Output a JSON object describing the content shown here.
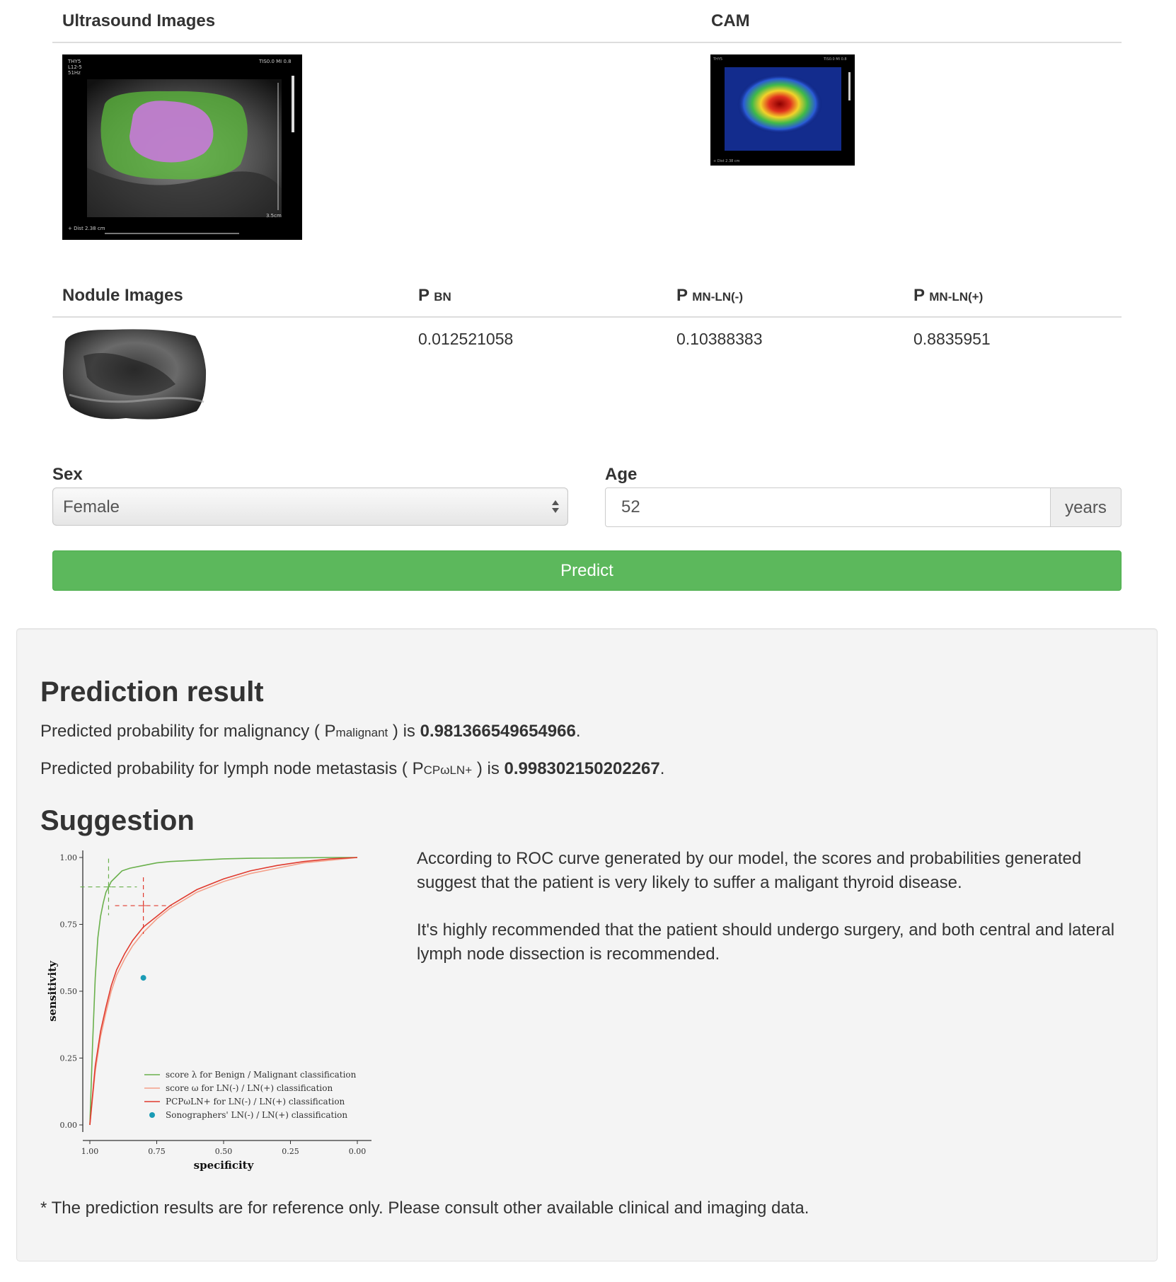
{
  "images_table": {
    "col1_header": "Ultrasound Images",
    "col2_header": "CAM"
  },
  "nodule_table": {
    "col1_header": "Nodule Images",
    "p_bn": {
      "main": "P",
      "sub": "BN",
      "value": "0.012521058"
    },
    "p_mn_ln_neg": {
      "main": "P",
      "sub": "MN-LN(-)",
      "value": "0.10388383"
    },
    "p_mn_ln_pos": {
      "main": "P",
      "sub": "MN-LN(+)",
      "value": "0.8835951"
    }
  },
  "form": {
    "sex_label": "Sex",
    "sex_value": "Female",
    "age_label": "Age",
    "age_value": "52",
    "age_unit": "years",
    "predict_label": "Predict"
  },
  "result": {
    "title": "Prediction result",
    "line1_prefix": "Predicted probability for malignancy ( ",
    "line1_sym_main": "P",
    "line1_sym_sub": "malignant",
    "line1_mid": " ) is ",
    "line1_value": "0.981366549654966",
    "line1_end": ".",
    "line2_prefix": "Predicted probability for lymph node metastasis ( ",
    "line2_sym_main": "P",
    "line2_sym_sub": "CPωLN+",
    "line2_mid": " ) is ",
    "line2_value": "0.998302150202267",
    "line2_end": "."
  },
  "suggestion": {
    "title": "Suggestion",
    "para1": "According to ROC curve generated by our model, the scores and probabilities generated suggest that the patient is very likely to suffer a maligant thyroid disease.",
    "para2": "It's highly recommended that the patient should undergo surgery, and both central and lateral lymph node dissection is recommended."
  },
  "note": "* The prediction results are for reference only. Please consult other available clinical and imaging data.",
  "chart_data": {
    "type": "line",
    "xlabel": "specificity",
    "ylabel": "sensitivity",
    "x_reversed": true,
    "xlim": [
      1.0,
      0.0
    ],
    "ylim": [
      0.0,
      1.0
    ],
    "x_ticks": [
      "1.00",
      "0.75",
      "0.50",
      "0.25",
      "0.00"
    ],
    "y_ticks": [
      "0.00",
      "0.25",
      "0.50",
      "0.75",
      "1.00"
    ],
    "legend_position": "bottom-right",
    "series": [
      {
        "name": "score λ for Benign / Malignant classification",
        "color": "#6ab04c",
        "specificity": [
          1.0,
          0.99,
          0.98,
          0.97,
          0.96,
          0.95,
          0.94,
          0.93,
          0.92,
          0.9,
          0.88,
          0.85,
          0.8,
          0.75,
          0.7,
          0.6,
          0.5,
          0.4,
          0.3,
          0.2,
          0.1,
          0.0
        ],
        "sensitivity": [
          0.0,
          0.3,
          0.55,
          0.7,
          0.78,
          0.83,
          0.87,
          0.89,
          0.91,
          0.93,
          0.95,
          0.96,
          0.97,
          0.98,
          0.985,
          0.99,
          0.995,
          0.997,
          0.998,
          0.999,
          1.0,
          1.0
        ]
      },
      {
        "name": "score ω for LN(-) / LN(+) classification",
        "color": "#f4a08a",
        "specificity": [
          1.0,
          0.98,
          0.96,
          0.94,
          0.92,
          0.9,
          0.87,
          0.84,
          0.8,
          0.75,
          0.7,
          0.65,
          0.6,
          0.5,
          0.4,
          0.3,
          0.2,
          0.1,
          0.0
        ],
        "sensitivity": [
          0.0,
          0.2,
          0.33,
          0.42,
          0.5,
          0.56,
          0.62,
          0.67,
          0.72,
          0.77,
          0.81,
          0.84,
          0.87,
          0.91,
          0.94,
          0.96,
          0.98,
          0.99,
          1.0
        ]
      },
      {
        "name": "PCPωLN+ for LN(-) / LN(+) classification",
        "color": "#e03a2e",
        "specificity": [
          1.0,
          0.98,
          0.96,
          0.94,
          0.92,
          0.9,
          0.87,
          0.84,
          0.8,
          0.75,
          0.7,
          0.65,
          0.6,
          0.5,
          0.4,
          0.3,
          0.2,
          0.1,
          0.0
        ],
        "sensitivity": [
          0.0,
          0.22,
          0.35,
          0.44,
          0.52,
          0.58,
          0.64,
          0.69,
          0.74,
          0.78,
          0.82,
          0.85,
          0.88,
          0.92,
          0.95,
          0.97,
          0.985,
          0.995,
          1.0
        ]
      }
    ],
    "points": [
      {
        "name": "Sonographers' LN(-) / LN(+) classification",
        "color": "#1a9bb5",
        "specificity": 0.8,
        "sensitivity": 0.55
      }
    ],
    "cutoffs": [
      {
        "series": "score λ for Benign / Malignant classification",
        "color": "#6ab04c",
        "specificity": 0.93,
        "sensitivity": 0.89
      },
      {
        "series": "PCPωLN+ for LN(-) / LN(+) classification",
        "color": "#e03a2e",
        "specificity": 0.8,
        "sensitivity": 0.82
      }
    ]
  }
}
